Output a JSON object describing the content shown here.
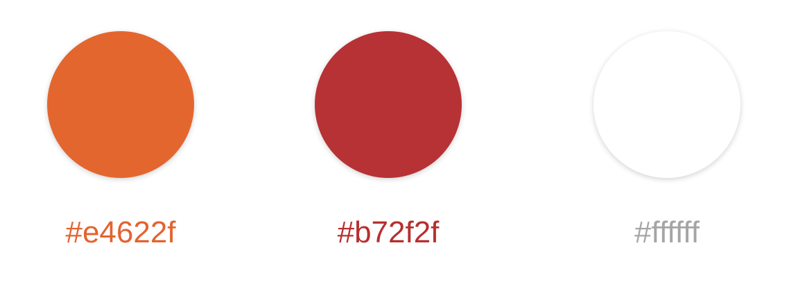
{
  "swatches": [
    {
      "hex_label": "#e4622f",
      "fill": "#e4662f",
      "text_color": "#e4622f"
    },
    {
      "hex_label": "#b72f2f",
      "fill": "#b73235",
      "text_color": "#b72f2f"
    },
    {
      "hex_label": "#ffffff",
      "fill": "#ffffff",
      "text_color": "#a5a5a5"
    }
  ]
}
